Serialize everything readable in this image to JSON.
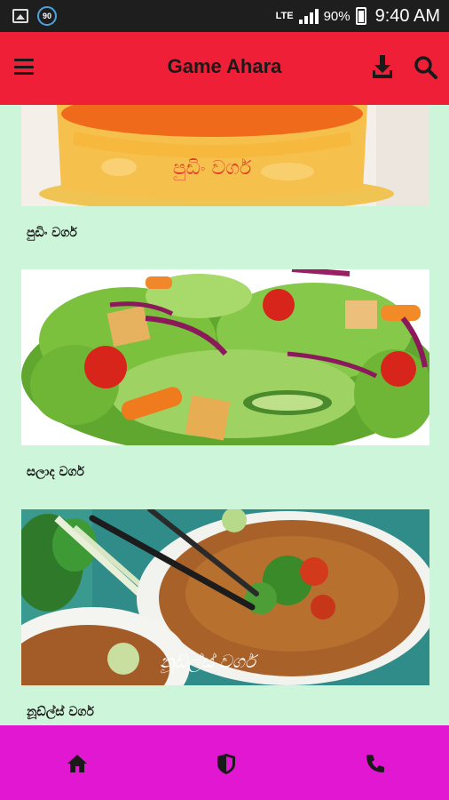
{
  "status_bar": {
    "badge": "90",
    "network": "LTE",
    "battery": "90%",
    "time": "9:40 AM"
  },
  "app_bar": {
    "title": "Game Ahara",
    "icons": [
      "menu-icon",
      "download-icon",
      "search-icon"
    ]
  },
  "categories": [
    {
      "label": "පුඩිං වර්ග",
      "image_caption": "පුඩිං වර්ග"
    },
    {
      "label": "සලාද වර්ග"
    },
    {
      "label": "නූඩ්ල්ස් වර්ග",
      "image_caption": "නූඩ්ල්ස් වර්ග"
    }
  ],
  "bottom_nav": {
    "icons": [
      "home-icon",
      "shield-icon",
      "phone-icon"
    ]
  },
  "colors": {
    "app_bar": "#ef1f37",
    "bottom_bar": "#e117d2",
    "background": "#cdf5d9"
  }
}
